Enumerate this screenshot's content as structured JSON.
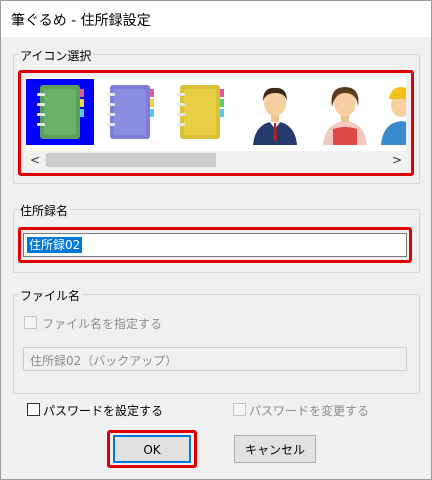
{
  "window": {
    "title": "筆ぐるめ - 住所録設定"
  },
  "icon_group": {
    "label": "アイコン選択",
    "icons": [
      {
        "name": "notebook-green-icon",
        "color": "#5aa05a",
        "selected": true
      },
      {
        "name": "notebook-purple-icon",
        "color": "#7b7fd6",
        "selected": false
      },
      {
        "name": "notebook-yellow-icon",
        "color": "#d9c23a",
        "selected": false
      },
      {
        "name": "man-icon",
        "selected": false
      },
      {
        "name": "woman-icon",
        "selected": false
      },
      {
        "name": "worker-icon",
        "selected": false
      }
    ],
    "scroll_left": "<",
    "scroll_right": ">"
  },
  "addressbook_group": {
    "label": "住所録名",
    "value": "住所録02"
  },
  "file_group": {
    "label": "ファイル名",
    "specify_label": "ファイル名を指定する",
    "file_value": "住所録02（バックアップ）"
  },
  "password": {
    "set_label": "パスワードを設定する",
    "change_label": "パスワードを変更する"
  },
  "buttons": {
    "ok": "OK",
    "cancel": "キャンセル"
  },
  "colors": {
    "highlight": "#e00000",
    "selection": "#0078d7",
    "selected_icon_bg": "#0000ff"
  }
}
